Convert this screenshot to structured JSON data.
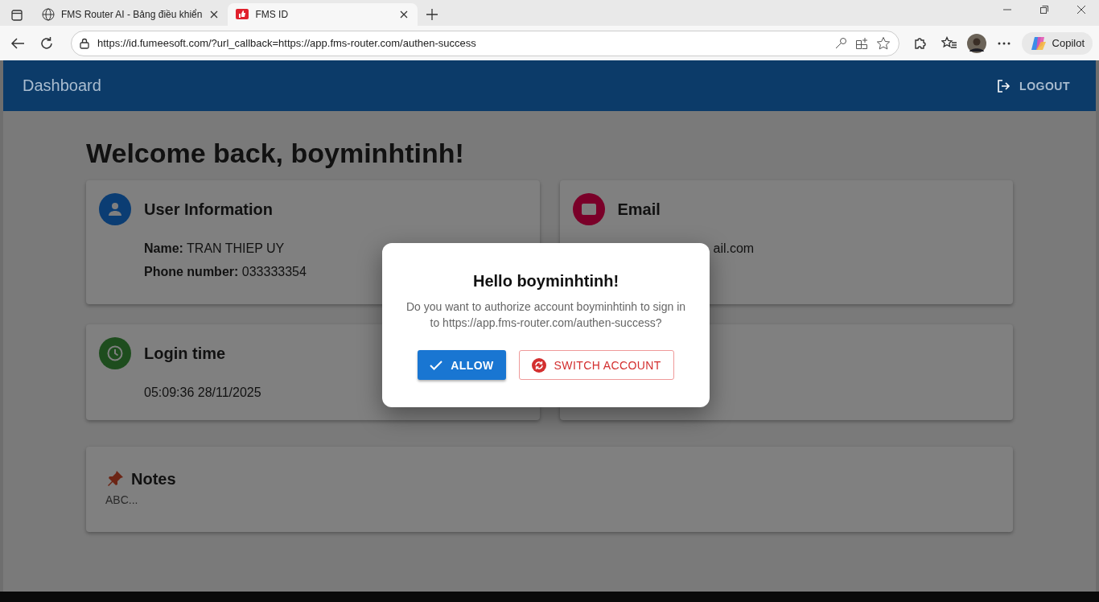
{
  "browser": {
    "tabs": [
      {
        "title": "FMS Router AI - Bảng điều khiển",
        "selected": false
      },
      {
        "title": "FMS ID",
        "selected": true
      }
    ],
    "url": "https://id.fumeesoft.com/?url_callback=https://app.fms-router.com/authen-success",
    "copilot": "Copilot"
  },
  "app_bar": {
    "title": "Dashboard",
    "logout": "LOGOUT"
  },
  "welcome": "Welcome back, boyminhtinh!",
  "cards": [
    {
      "kind": "user",
      "title": "User Information",
      "color": "#0b3d73",
      "fields": [
        {
          "label": "Name:",
          "value": "TRAN THIEP UY"
        },
        {
          "label": "Phone number:",
          "value": "033333354"
        }
      ]
    },
    {
      "kind": "email",
      "title": "Email",
      "color": "#7a0029",
      "text": "ail.com"
    },
    {
      "kind": "time",
      "title": "Login time",
      "color": "#1e4d1e",
      "text": "05:09:36 28/11/2025"
    },
    {
      "kind": "blank"
    }
  ],
  "notes": {
    "title": "Notes",
    "text": "ABC..."
  },
  "dialog": {
    "title": "Hello boyminhtinh!",
    "message": "Do you want to authorize account boyminhtinh to sign in to https://app.fms-router.com/authen-success?",
    "allow": "ALLOW",
    "switch": "SWITCH ACCOUNT"
  }
}
